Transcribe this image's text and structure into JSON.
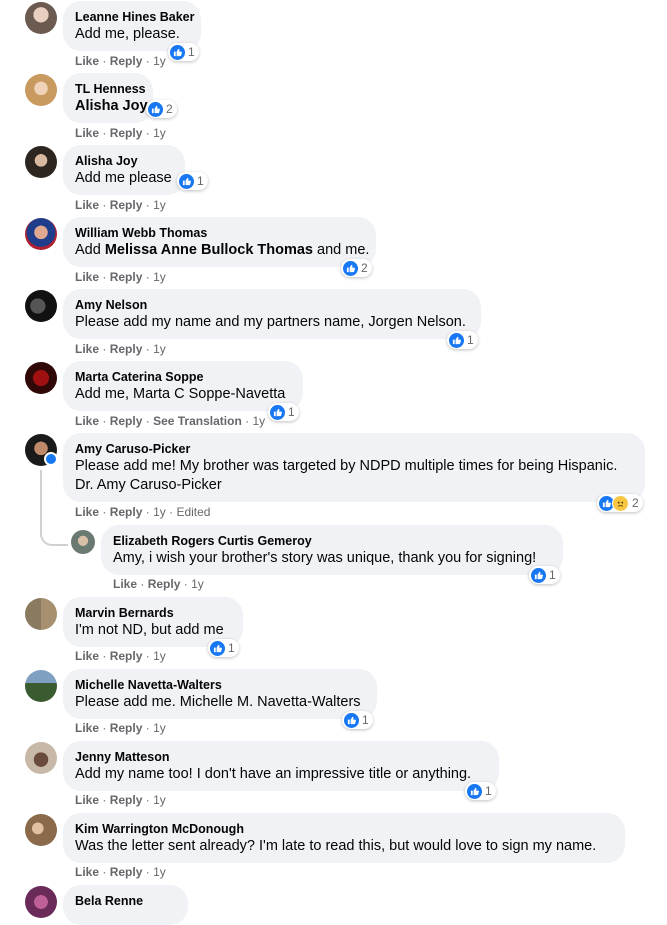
{
  "actions": {
    "like": "Like",
    "reply": "Reply",
    "see_translation": "See Translation",
    "edited": "Edited",
    "sep": "·",
    "age": "1y"
  },
  "comments": [
    {
      "name": "Leanne Hines Baker",
      "text": "Add me, please.",
      "likes": "1"
    },
    {
      "name": "TL Henness",
      "text": "Alisha Joy",
      "likes": "2"
    },
    {
      "name": "Alisha Joy",
      "text": "Add me please",
      "likes": "1"
    },
    {
      "name": "William Webb Thomas",
      "text_pre": "Add ",
      "text_bold": "Melissa Anne Bullock Thomas",
      "text_post": " and me.",
      "likes": "2"
    },
    {
      "name": "Amy Nelson",
      "text": "Please add my name and my partners name, Jorgen Nelson.",
      "likes": "1"
    },
    {
      "name": "Marta Caterina Soppe",
      "text": "Add me, Marta C Soppe-Navetta",
      "likes": "1"
    },
    {
      "name": "Amy Caruso-Picker",
      "text_line1": "Please add me! My brother was targeted by NDPD multiple times for being Hispanic.",
      "text_line2": "Dr. Amy Caruso-Picker",
      "likes": "2"
    },
    {
      "name": "Elizabeth Rogers Curtis Gemeroy",
      "text": "Amy, i wish your brother's story was unique, thank you for signing!",
      "likes": "1"
    },
    {
      "name": "Marvin Bernards",
      "text": "I'm not ND, but add me",
      "likes": "1"
    },
    {
      "name": "Michelle Navetta-Walters",
      "text": "Please add me. Michelle M. Navetta-Walters",
      "likes": "1"
    },
    {
      "name": "Jenny Matteson",
      "text": "Add my name too! I don't have an impressive title or anything.",
      "likes": "1"
    },
    {
      "name": "Kim Warrington McDonough",
      "text": "Was the letter sent already? I'm late to read this, but would love to sign my name.",
      "likes": ""
    },
    {
      "name": "Bela Renne",
      "text": "",
      "likes": ""
    }
  ],
  "colors": {
    "bubble": "#f0f2f5",
    "like_blue": "#1877f2",
    "meta_gray": "#65676b"
  }
}
